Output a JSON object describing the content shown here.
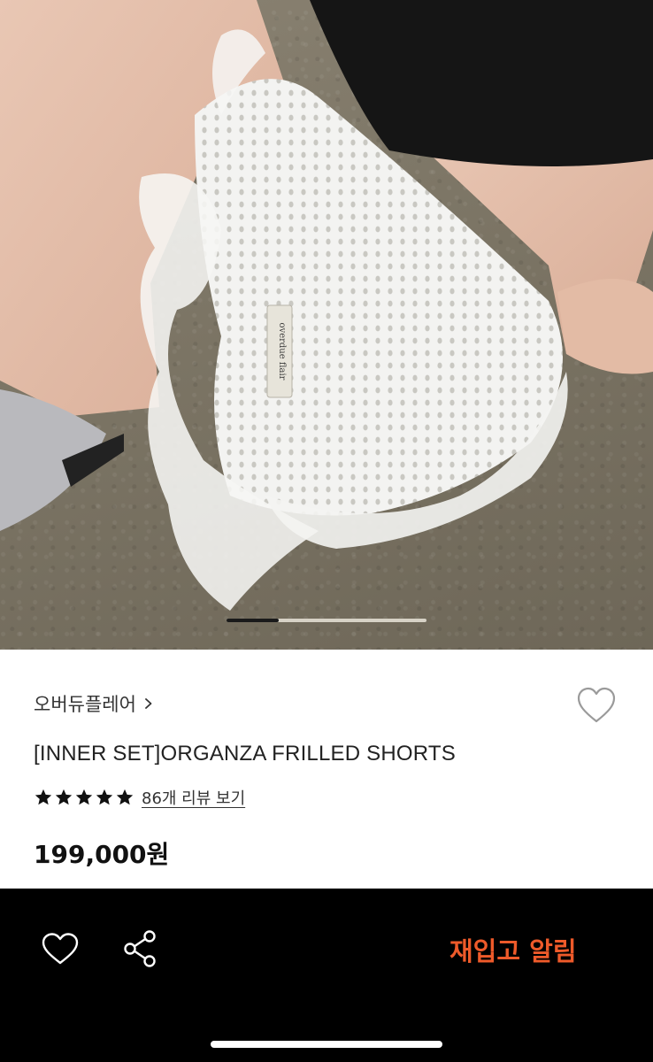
{
  "product": {
    "brand": "오버듀플레어",
    "title": "[INNER SET]ORGANZA FRILLED SHORTS",
    "rating_stars": 5,
    "review_link": "86개 리뷰 보기",
    "price": "199,000원"
  },
  "gallery": {
    "current_slide_fraction": 0.26,
    "label_tag": "overdue flair"
  },
  "bottom_bar": {
    "restock_label": "재입고 알림"
  },
  "colors": {
    "accent": "#ee5a2a",
    "bar_bg": "#000000"
  },
  "icons": {
    "wishlist": "heart-outline-icon",
    "share": "share-icon",
    "brand_link": "chevron-right-icon",
    "rating": "star-icon"
  }
}
